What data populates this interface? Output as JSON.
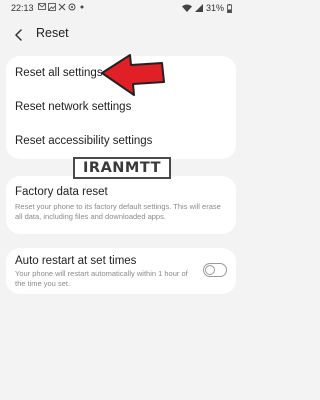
{
  "status_bar": {
    "time": "22:13",
    "notification_icons": [
      "gmail-icon",
      "image-icon",
      "crossed-icon",
      "settings-icon",
      "dot-icon"
    ],
    "battery": "31%"
  },
  "header": {
    "title": "Reset"
  },
  "reset_options": [
    {
      "label": "Reset all settings"
    },
    {
      "label": "Reset network settings"
    },
    {
      "label": "Reset accessibility settings"
    }
  ],
  "factory_reset": {
    "title": "Factory data reset",
    "description": "Reset your phone to its factory default settings. This will erase all data, including files and downloaded apps."
  },
  "auto_restart": {
    "title": "Auto restart at set times",
    "description": "Your phone will restart automatically within 1 hour of the time you set.",
    "toggle_on": false
  },
  "watermark": {
    "text": "IRANMTT"
  },
  "colors": {
    "background": "#f3f3f3",
    "card": "#ffffff",
    "arrow_fill": "#e01f26",
    "arrow_stroke": "#222222"
  }
}
